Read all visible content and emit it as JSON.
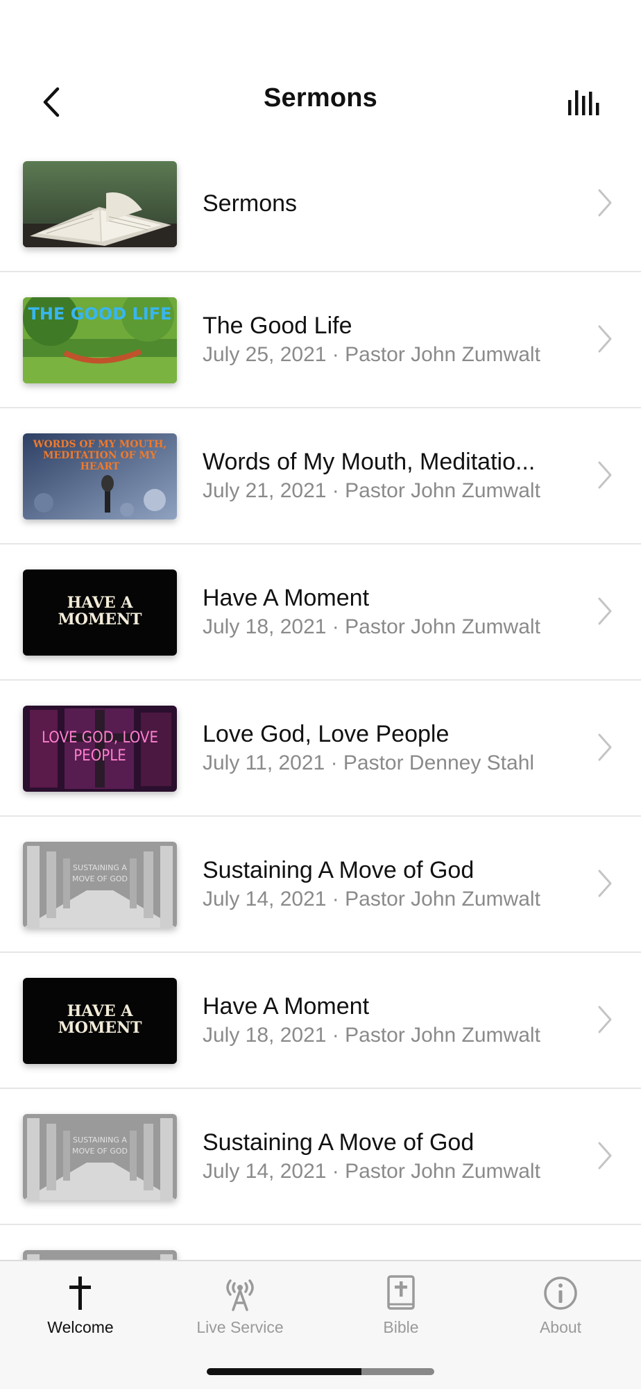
{
  "header": {
    "title": "Sermons",
    "back_icon": "chevron-left-icon",
    "menu_icon": "audio-bars-icon"
  },
  "sermons": [
    {
      "title": "Sermons",
      "subtitle": "",
      "thumbnail": "open-bible-photo",
      "thumbnail_text": ""
    },
    {
      "title": "The Good Life",
      "subtitle": "July 25, 2021 · Pastor John Zumwalt",
      "thumbnail": "park-hammock-photo",
      "thumbnail_text": "THE GOOD LIFE"
    },
    {
      "title": "Words of My Mouth, Meditatio...",
      "subtitle": "July 21, 2021 · Pastor John Zumwalt",
      "thumbnail": "microphone-crowd-photo",
      "thumbnail_text": "WORDS OF MY MOUTH, MEDITATION OF MY HEART"
    },
    {
      "title": "Have A Moment",
      "subtitle": "July 18, 2021 · Pastor John Zumwalt",
      "thumbnail": "black-text-card",
      "thumbnail_text": "HAVE A MOMENT"
    },
    {
      "title": "Love God, Love People",
      "subtitle": "July 11, 2021 · Pastor Denney Stahl",
      "thumbnail": "neon-cross-photo",
      "thumbnail_text": "LOVE GOD, LOVE PEOPLE"
    },
    {
      "title": "Sustaining A Move of God",
      "subtitle": "July 14, 2021 · Pastor John Zumwalt",
      "thumbnail": "columns-corridor-photo",
      "thumbnail_text": "SUSTAINING A MOVE OF GOD"
    },
    {
      "title": "Have A Moment",
      "subtitle": "July 18, 2021 · Pastor John Zumwalt",
      "thumbnail": "black-text-card",
      "thumbnail_text": "HAVE A MOMENT"
    },
    {
      "title": "Sustaining A Move of God",
      "subtitle": "July 14, 2021 · Pastor John Zumwalt",
      "thumbnail": "columns-corridor-photo",
      "thumbnail_text": "SUSTAINING A MOVE OF GOD"
    }
  ],
  "tabbar": {
    "tabs": [
      {
        "label": "Welcome",
        "icon": "cross-icon",
        "active": true
      },
      {
        "label": "Live Service",
        "icon": "broadcast-tower-icon",
        "active": false
      },
      {
        "label": "Bible",
        "icon": "bible-book-icon",
        "active": false
      },
      {
        "label": "About",
        "icon": "info-circle-icon",
        "active": false
      }
    ]
  },
  "colors": {
    "text_primary": "#111111",
    "text_secondary": "#8a8a8a",
    "divider": "#e6e6e6",
    "tab_inactive": "#9a9a9a",
    "tabbar_bg": "#f7f7f7"
  }
}
